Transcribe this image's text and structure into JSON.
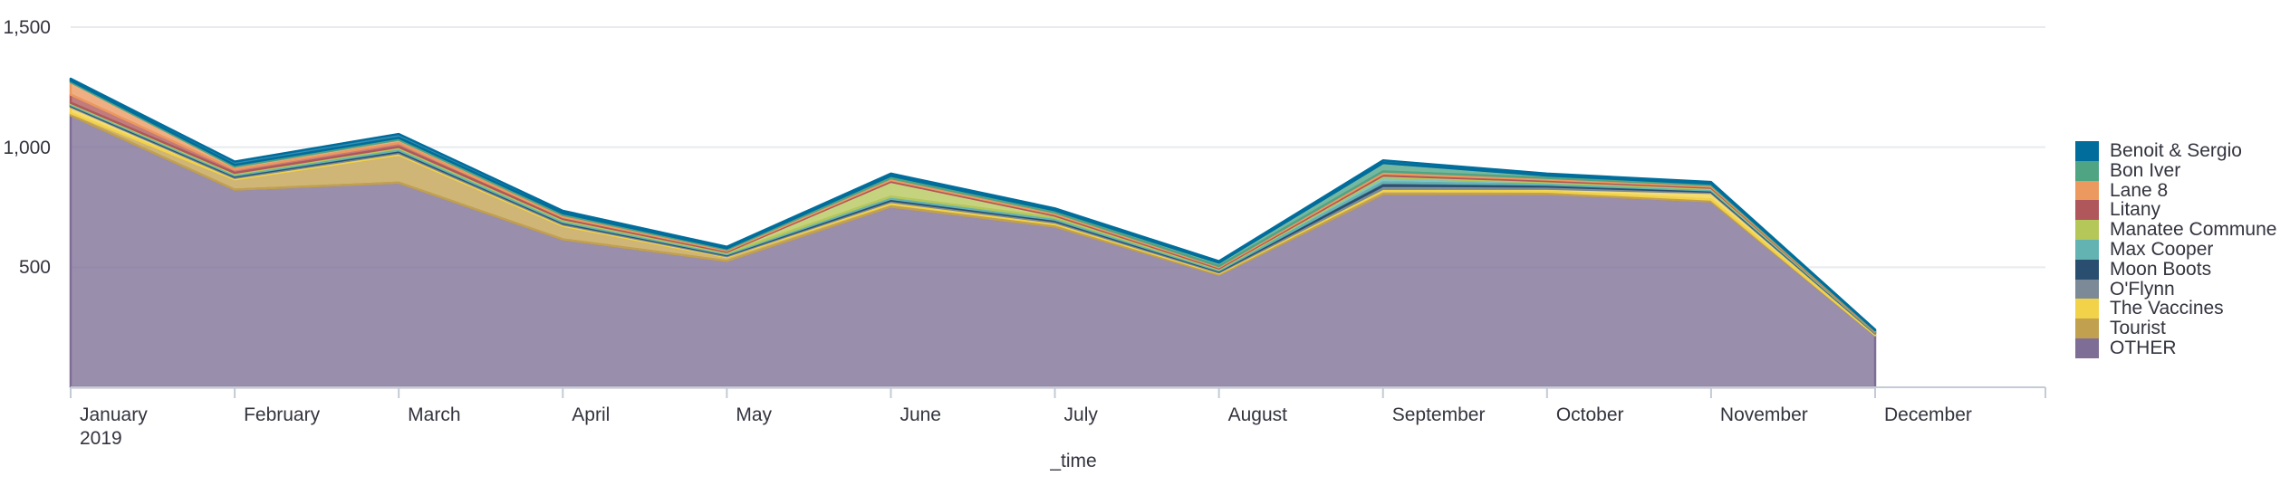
{
  "chart_data": {
    "type": "area",
    "stacked": true,
    "title": "",
    "subtitle": "",
    "xlabel": "_time",
    "ylabel": "",
    "grid": true,
    "legend_position": "right",
    "ylim": [
      0,
      1500
    ],
    "y_ticks": [
      500,
      1000,
      1500
    ],
    "y_tick_labels": [
      "500",
      "1,000",
      "1,500"
    ],
    "categories": [
      "January",
      "February",
      "March",
      "April",
      "May",
      "June",
      "July",
      "August",
      "September",
      "October",
      "November",
      "December"
    ],
    "x_tick_labels": [
      "January",
      "February",
      "March",
      "April",
      "May",
      "June",
      "July",
      "August",
      "September",
      "October",
      "November",
      "December"
    ],
    "x_axis_year": "2019",
    "totals": [
      1285,
      940,
      1055,
      735,
      585,
      890,
      745,
      525,
      945,
      890,
      855,
      240
    ],
    "series": [
      {
        "name": "Benoit & Sergio",
        "color": "#006d9c",
        "values": [
          8,
          14,
          16,
          10,
          6,
          9,
          8,
          6,
          11,
          8,
          7,
          2
        ]
      },
      {
        "name": "Bon Iver",
        "color": "#4fa484",
        "values": [
          6,
          7,
          8,
          7,
          5,
          10,
          9,
          14,
          35,
          10,
          6,
          2
        ]
      },
      {
        "name": "Lane 8",
        "color": "#ec9960",
        "values": [
          52,
          12,
          14,
          9,
          5,
          8,
          7,
          5,
          9,
          7,
          6,
          2
        ]
      },
      {
        "name": "Litany",
        "color": "#af575a",
        "values": [
          34,
          14,
          16,
          8,
          5,
          7,
          6,
          5,
          8,
          6,
          5,
          2
        ]
      },
      {
        "name": "Manatee Commune",
        "color": "#b6c75a",
        "values": [
          4,
          5,
          6,
          6,
          5,
          62,
          9,
          4,
          7,
          6,
          5,
          2
        ]
      },
      {
        "name": "Max Cooper",
        "color": "#62b3b2",
        "values": [
          5,
          6,
          8,
          7,
          5,
          9,
          8,
          5,
          22,
          9,
          6,
          2
        ]
      },
      {
        "name": "Moon Boots",
        "color": "#294e70",
        "values": [
          4,
          5,
          6,
          5,
          4,
          7,
          6,
          4,
          14,
          8,
          5,
          2
        ]
      },
      {
        "name": "O'Flynn",
        "color": "#7b8a96",
        "values": [
          4,
          5,
          6,
          5,
          4,
          6,
          6,
          4,
          12,
          9,
          5,
          2
        ]
      },
      {
        "name": "The Vaccines",
        "color": "#f2d249",
        "values": [
          26,
          6,
          7,
          6,
          4,
          8,
          7,
          4,
          9,
          12,
          28,
          6
        ]
      },
      {
        "name": "Tourist",
        "color": "#c1a04f",
        "values": [
          9,
          43,
          116,
          56,
          16,
          12,
          10,
          6,
          14,
          10,
          8,
          2
        ]
      },
      {
        "name": "OTHER",
        "color": "#7e6e96",
        "values": [
          1133,
          823,
          852,
          616,
          526,
          752,
          669,
          468,
          804,
          805,
          774,
          216
        ]
      }
    ]
  },
  "axis": {
    "x_title": "_time",
    "year_label": "2019"
  },
  "legend": {
    "items": [
      {
        "label": "Benoit & Sergio",
        "color": "#006d9c"
      },
      {
        "label": "Bon Iver",
        "color": "#4fa484"
      },
      {
        "label": "Lane 8",
        "color": "#ec9960"
      },
      {
        "label": "Litany",
        "color": "#af575a"
      },
      {
        "label": "Manatee Commune",
        "color": "#b6c75a"
      },
      {
        "label": "Max Cooper",
        "color": "#62b3b2"
      },
      {
        "label": "Moon Boots",
        "color": "#294e70"
      },
      {
        "label": "O'Flynn",
        "color": "#7b8a96"
      },
      {
        "label": "The Vaccines",
        "color": "#f2d249"
      },
      {
        "label": "Tourist",
        "color": "#c1a04f"
      },
      {
        "label": "OTHER",
        "color": "#7e6e96"
      }
    ]
  },
  "style": {
    "gridline_color": "#e8eaed",
    "axis_color": "#c3cbd4",
    "text_color": "#33343e",
    "background": "#ffffff"
  }
}
